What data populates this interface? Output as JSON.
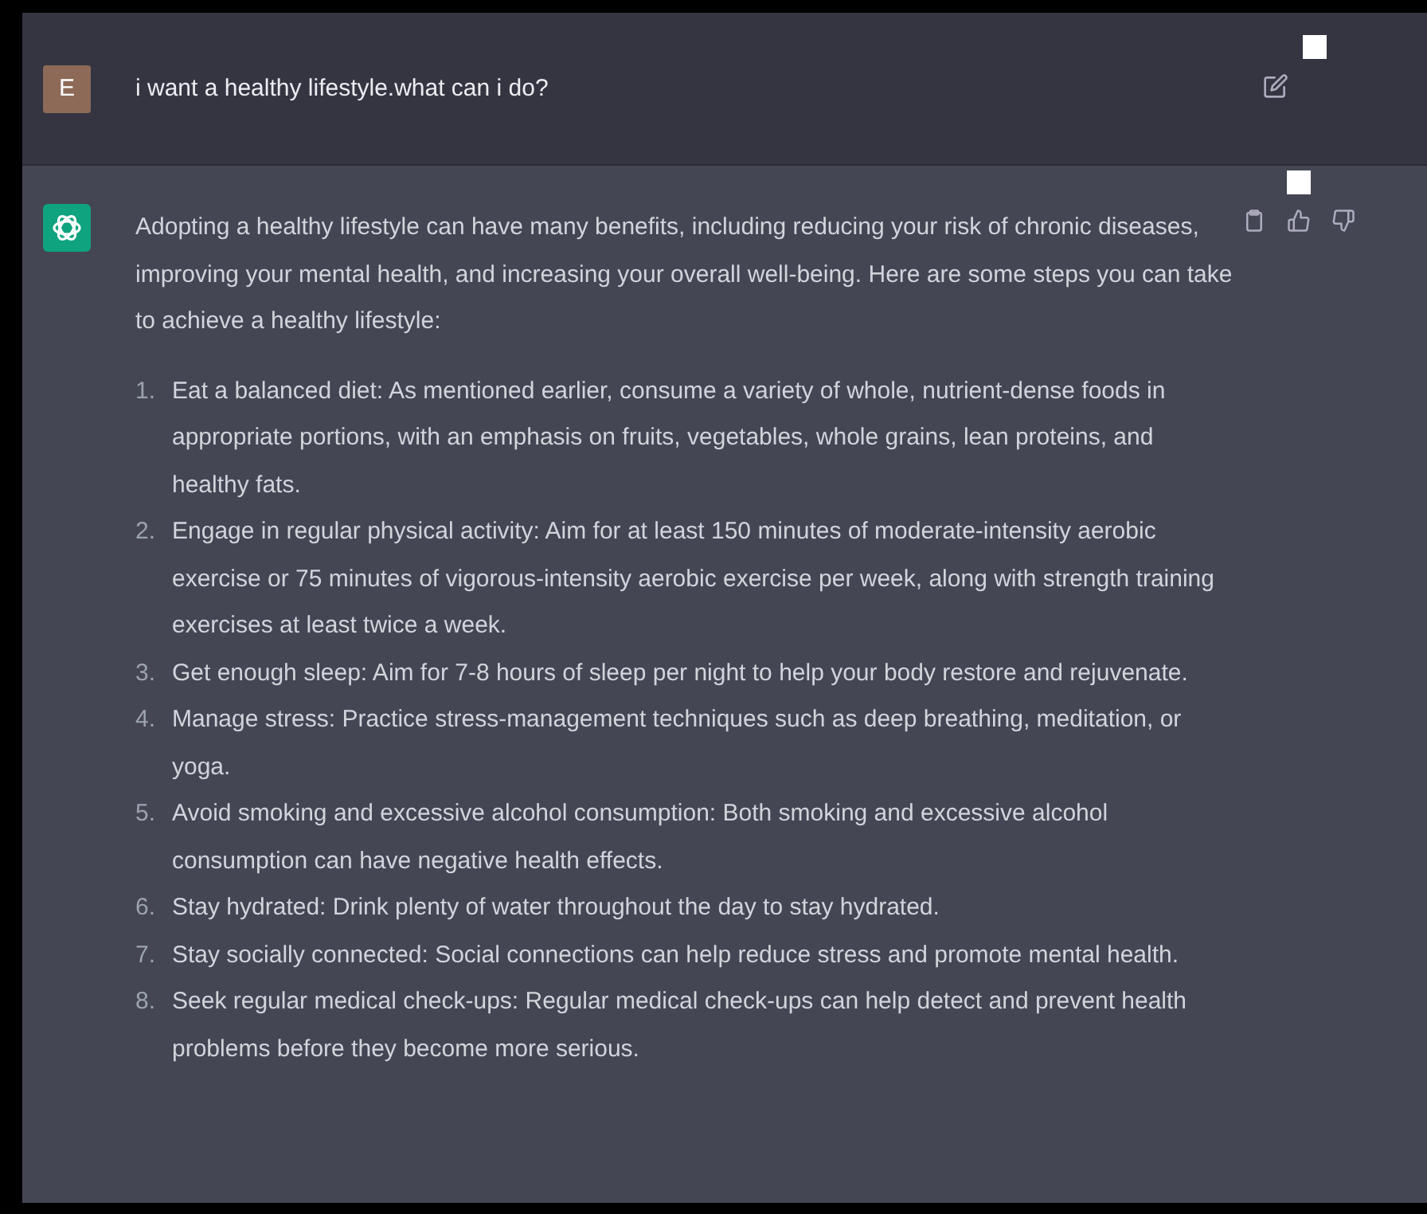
{
  "user_message": {
    "avatar_letter": "E",
    "text": "i want a healthy lifestyle.what can i do?"
  },
  "assistant_message": {
    "intro": "Adopting a healthy lifestyle can have many benefits, including reducing your risk of chronic diseases, improving your mental health, and increasing your overall well-being. Here are some steps you can take to achieve a healthy lifestyle:",
    "steps": [
      {
        "number": "1.",
        "text": "Eat a balanced diet: As mentioned earlier, consume a variety of whole, nutrient-dense foods in appropriate portions, with an emphasis on fruits, vegetables, whole grains, lean proteins, and healthy fats."
      },
      {
        "number": "2.",
        "text": "Engage in regular physical activity: Aim for at least 150 minutes of moderate-intensity aerobic exercise or 75 minutes of vigorous-intensity aerobic exercise per week, along with strength training exercises at least twice a week."
      },
      {
        "number": "3.",
        "text": "Get enough sleep: Aim for 7-8 hours of sleep per night to help your body restore and rejuvenate."
      },
      {
        "number": "4.",
        "text": "Manage stress: Practice stress-management techniques such as deep breathing, meditation, or yoga."
      },
      {
        "number": "5.",
        "text": "Avoid smoking and excessive alcohol consumption: Both smoking and excessive alcohol consumption can have negative health effects."
      },
      {
        "number": "6.",
        "text": "Stay hydrated: Drink plenty of water throughout the day to stay hydrated."
      },
      {
        "number": "7.",
        "text": "Stay socially connected: Social connections can help reduce stress and promote mental health."
      },
      {
        "number": "8.",
        "text": "Seek regular medical check-ups: Regular medical check-ups can help detect and prevent health problems before they become more serious."
      }
    ]
  }
}
